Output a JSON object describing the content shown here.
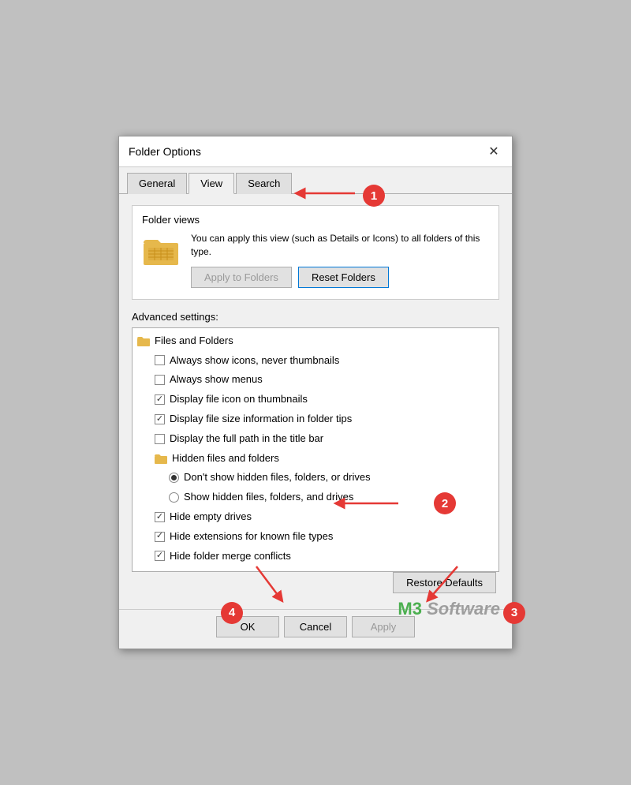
{
  "dialog": {
    "title": "Folder Options",
    "close_label": "✕"
  },
  "tabs": [
    {
      "label": "General",
      "active": false
    },
    {
      "label": "View",
      "active": true
    },
    {
      "label": "Search",
      "active": false
    }
  ],
  "folder_views": {
    "section_label": "Folder views",
    "description": "You can apply this view (such as Details or Icons) to all folders of this type.",
    "apply_btn": "Apply to Folders",
    "reset_btn": "Reset Folders"
  },
  "advanced": {
    "label": "Advanced settings:",
    "items": [
      {
        "type": "group",
        "icon": "folder",
        "text": "Files and Folders",
        "indent": 0
      },
      {
        "type": "checkbox",
        "checked": false,
        "text": "Always show icons, never thumbnails",
        "indent": 1
      },
      {
        "type": "checkbox",
        "checked": false,
        "text": "Always show menus",
        "indent": 1
      },
      {
        "type": "checkbox",
        "checked": true,
        "text": "Display file icon on thumbnails",
        "indent": 1
      },
      {
        "type": "checkbox",
        "checked": true,
        "text": "Display file size information in folder tips",
        "indent": 1
      },
      {
        "type": "checkbox",
        "checked": false,
        "text": "Display the full path in the title bar",
        "indent": 1
      },
      {
        "type": "group",
        "icon": "folder",
        "text": "Hidden files and folders",
        "indent": 1
      },
      {
        "type": "radio",
        "selected": true,
        "text": "Don't show hidden files, folders, or drives",
        "indent": 2
      },
      {
        "type": "radio",
        "selected": false,
        "text": "Show hidden files, folders, and drives",
        "indent": 2
      },
      {
        "type": "checkbox",
        "checked": true,
        "text": "Hide empty drives",
        "indent": 1
      },
      {
        "type": "checkbox",
        "checked": true,
        "text": "Hide extensions for known file types",
        "indent": 1
      },
      {
        "type": "checkbox",
        "checked": true,
        "text": "Hide folder merge conflicts",
        "indent": 1
      }
    ],
    "restore_btn": "Restore Defaults"
  },
  "footer": {
    "ok": "OK",
    "cancel": "Cancel",
    "apply": "Apply"
  },
  "watermark": {
    "m3": "M3",
    "software": " Software"
  },
  "badges": [
    "1",
    "2",
    "3",
    "4"
  ]
}
